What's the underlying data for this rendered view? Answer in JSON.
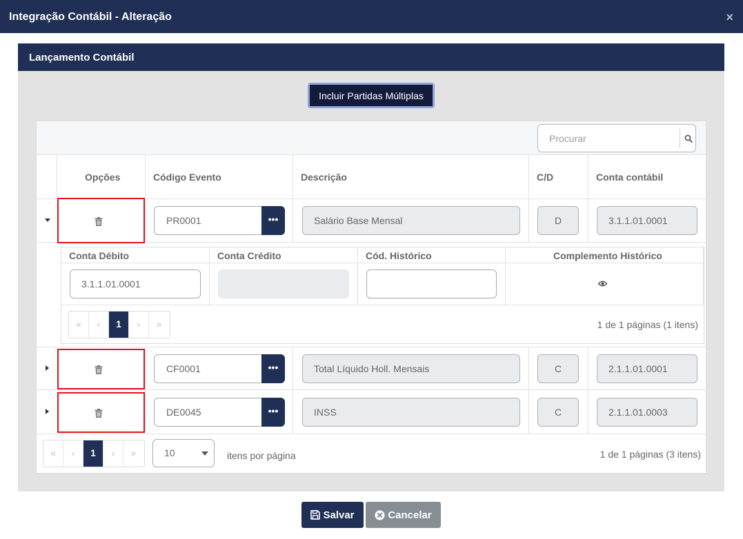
{
  "dialog": {
    "title": "Integração Contábil - Alteração",
    "close_glyph": "×"
  },
  "section": {
    "title": "Lançamento Contábil"
  },
  "toolbar": {
    "include_multi_label": "Incluir Partidas Múltiplas",
    "search_placeholder": "Procurar"
  },
  "columns": {
    "options": "Opções",
    "event_code": "Código Evento",
    "description": "Descrição",
    "cd": "C/D",
    "account": "Conta contábil"
  },
  "rows": [
    {
      "expanded": true,
      "event_code": "PR0001",
      "description": "Salário Base Mensal",
      "cd": "D",
      "account": "3.1.1.01.0001"
    },
    {
      "expanded": false,
      "event_code": "CF0001",
      "description": "Total Líquido Holl. Mensais",
      "cd": "C",
      "account": "2.1.1.01.0001"
    },
    {
      "expanded": false,
      "event_code": "DE0045",
      "description": "INSS",
      "cd": "C",
      "account": "2.1.1.01.0003"
    }
  ],
  "lookup_button_glyph": "•••",
  "detail": {
    "headers": {
      "debit": "Conta Débito",
      "credit": "Conta Crédito",
      "history_code": "Cód. Histórico",
      "history_complement": "Complemento Histórico"
    },
    "debit_value": "3.1.1.01.0001",
    "credit_value": "",
    "history_code_value": "",
    "pager": {
      "first": "«",
      "prev": "‹",
      "page": "1",
      "next": "›",
      "last": "»"
    },
    "info": "1 de 1 páginas (1 itens)"
  },
  "footer": {
    "pager": {
      "first": "«",
      "prev": "‹",
      "page": "1",
      "next": "›",
      "last": "»"
    },
    "page_size": "10",
    "page_size_label": "itens por página",
    "info": "1 de 1 páginas (3 itens)"
  },
  "actions": {
    "save_label": "Salvar",
    "cancel_label": "Cancelar"
  },
  "colors": {
    "navy": "#1f2f55",
    "highlight_red": "#e1141b",
    "cancel_gray": "#868d93"
  },
  "icons": [
    "close-icon",
    "search-icon",
    "trash-icon",
    "caret-down-icon",
    "caret-right-icon",
    "eye-icon",
    "save-icon",
    "cancel-circle-icon"
  ]
}
